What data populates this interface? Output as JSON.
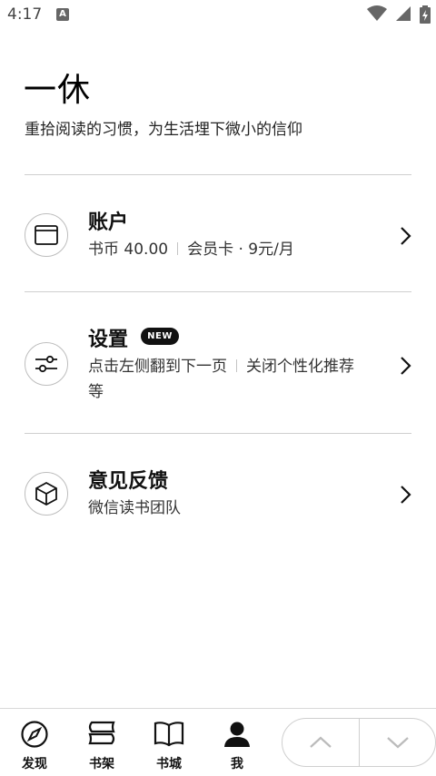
{
  "status_bar": {
    "time": "4:17",
    "notification_letter": "A"
  },
  "profile": {
    "name": "一休",
    "motto": "重拾阅读的习惯，为生活埋下微小的信仰"
  },
  "menu": {
    "account": {
      "title": "账户",
      "coins": "书币 40.00",
      "membership": "会员卡 · 9元/月",
      "icon": "wallet-icon"
    },
    "settings": {
      "title": "设置",
      "badge": "NEW",
      "line1_left": "点击左侧翻到下一页",
      "line1_right": "关闭个性化推荐",
      "line2": "等",
      "icon": "sliders-icon"
    },
    "feedback": {
      "title": "意见反馈",
      "subtitle": "微信读书团队",
      "icon": "cube-icon"
    }
  },
  "tabs": [
    {
      "label": "发现",
      "icon": "compass-icon"
    },
    {
      "label": "书架",
      "icon": "bookshelf-icon"
    },
    {
      "label": "书城",
      "icon": "open-book-icon"
    },
    {
      "label": "我",
      "icon": "person-icon"
    }
  ],
  "colors": {
    "text": "#111111",
    "divider": "#cfcfcf",
    "badge_bg": "#111111"
  }
}
